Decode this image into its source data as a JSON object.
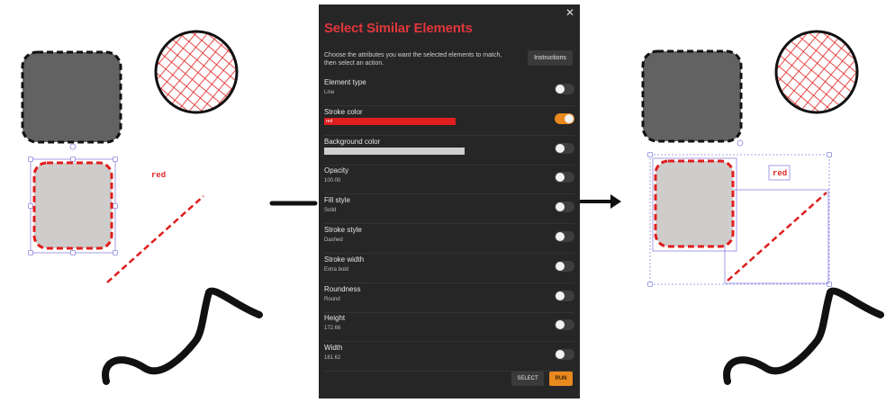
{
  "canvas": {
    "left_text_label": "red",
    "right_text_label": "red"
  },
  "dialog": {
    "title": "Select Similar Elements",
    "close_icon": "close-icon",
    "description": "Choose the attributes you want the selected elements to match, then select an action.",
    "instructions_label": "Instructions",
    "select_label": "SELECT",
    "run_label": "RUN",
    "accent_color": "#e8891f",
    "title_color": "#e0363c",
    "attributes": [
      {
        "label": "Element type",
        "value": "Line",
        "enabled": false
      },
      {
        "label": "Stroke color",
        "value": "red",
        "swatch": "#e01e1e",
        "enabled": true
      },
      {
        "label": "Background color",
        "value": "",
        "swatch": "#cfcfcf",
        "enabled": false
      },
      {
        "label": "Opacity",
        "value": "100.00",
        "enabled": false
      },
      {
        "label": "Fill style",
        "value": "Solid",
        "enabled": false
      },
      {
        "label": "Stroke style",
        "value": "Dashed",
        "enabled": false
      },
      {
        "label": "Stroke width",
        "value": "Extra bold",
        "enabled": false
      },
      {
        "label": "Roundness",
        "value": "Round",
        "enabled": false
      },
      {
        "label": "Height",
        "value": "172.66",
        "enabled": false
      },
      {
        "label": "Width",
        "value": "181.62",
        "enabled": false
      }
    ]
  }
}
